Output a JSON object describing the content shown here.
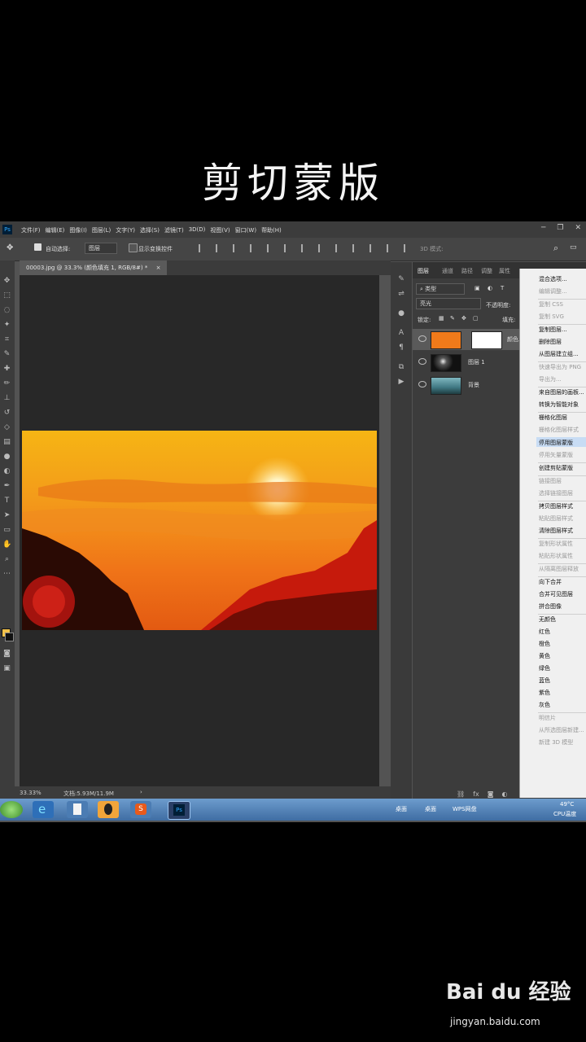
{
  "caption": "剪切蒙版",
  "app": {
    "logo": "Ps",
    "menu": [
      "文件(F)",
      "编辑(E)",
      "图像(I)",
      "图层(L)",
      "文字(Y)",
      "选择(S)",
      "滤镜(T)",
      "3D(D)",
      "视图(V)",
      "窗口(W)",
      "帮助(H)"
    ],
    "window_controls": [
      "─",
      "❐",
      "✕"
    ]
  },
  "options": {
    "auto_select_label": "自动选择:",
    "auto_select_value": "图层",
    "show_transform_label": "显示变换控件",
    "mode_3d_label": "3D 模式:"
  },
  "document": {
    "tab_title": "00003.jpg @ 33.3% (颜色填充 1, RGB/8#) *",
    "zoom": "33.33%",
    "doc_info": "文档:5.93M/11.9M"
  },
  "layers_panel": {
    "tabs": [
      "图层",
      "通道",
      "路径",
      "调整",
      "属性"
    ],
    "filter_kind": "类型",
    "blend_mode": "亮光",
    "opacity_label": "不透明度:",
    "lock_label": "锁定:",
    "fill_label": "填充:",
    "layers": [
      {
        "name": "颜色..."
      },
      {
        "name": "图层 1"
      },
      {
        "name": "背景"
      }
    ]
  },
  "context_menu": {
    "items": [
      {
        "label": "混合选项...",
        "enabled": true
      },
      {
        "label": "编辑调整...",
        "enabled": false
      },
      {
        "label": "复制 CSS",
        "enabled": false
      },
      {
        "label": "复制 SVG",
        "enabled": false
      },
      {
        "label": "复制图层...",
        "enabled": true
      },
      {
        "label": "删除图层",
        "enabled": true
      },
      {
        "label": "从图层建立组...",
        "enabled": true
      },
      {
        "label": "快速导出为 PNG",
        "enabled": false
      },
      {
        "label": "导出为...",
        "enabled": false
      },
      {
        "label": "来自图层的画板...",
        "enabled": true
      },
      {
        "label": "转换为智能对象",
        "enabled": true
      },
      {
        "label": "栅格化图层",
        "enabled": true
      },
      {
        "label": "栅格化图层样式",
        "enabled": false
      },
      {
        "label": "停用图层蒙版",
        "enabled": true,
        "highlighted": true
      },
      {
        "label": "停用矢量蒙版",
        "enabled": false
      },
      {
        "label": "创建剪贴蒙版",
        "enabled": true
      },
      {
        "label": "链接图层",
        "enabled": false
      },
      {
        "label": "选择链接图层",
        "enabled": false
      },
      {
        "label": "拷贝图层样式",
        "enabled": true
      },
      {
        "label": "粘贴图层样式",
        "enabled": false
      },
      {
        "label": "清除图层样式",
        "enabled": true
      },
      {
        "label": "复制形状属性",
        "enabled": false
      },
      {
        "label": "粘贴形状属性",
        "enabled": false
      },
      {
        "label": "从隔离图层释放",
        "enabled": false
      },
      {
        "label": "向下合并",
        "enabled": true
      },
      {
        "label": "合并可见图层",
        "enabled": true
      },
      {
        "label": "拼合图像",
        "enabled": true
      },
      {
        "label": "无颜色",
        "enabled": true
      },
      {
        "label": "红色",
        "enabled": true
      },
      {
        "label": "橙色",
        "enabled": true
      },
      {
        "label": "黄色",
        "enabled": true
      },
      {
        "label": "绿色",
        "enabled": true
      },
      {
        "label": "蓝色",
        "enabled": true
      },
      {
        "label": "紫色",
        "enabled": true
      },
      {
        "label": "灰色",
        "enabled": true
      },
      {
        "label": "明信片",
        "enabled": false
      },
      {
        "label": "从所选图层新建...",
        "enabled": false
      },
      {
        "label": "新建 3D 模型",
        "enabled": false
      }
    ]
  },
  "taskbar": {
    "tray_items": [
      "桌面",
      "桌面",
      "WPS网盘"
    ],
    "temperature": "49°C",
    "cpu_label": "CPU温度"
  },
  "watermark": {
    "brand": "Bai du 经验",
    "url": "jingyan.baidu.com"
  },
  "colors": {
    "accent": "#f07a1a",
    "ps_blue": "#31a8ff",
    "highlight": "#c8dcf4"
  }
}
